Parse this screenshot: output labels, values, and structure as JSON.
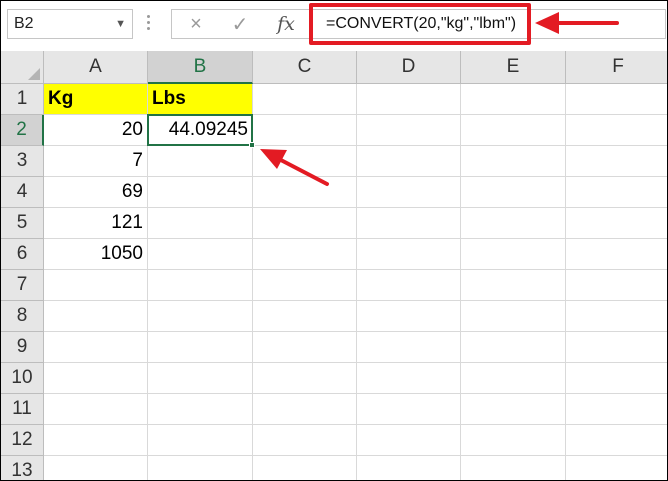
{
  "name_box": {
    "value": "B2"
  },
  "formula_bar": {
    "cancel_icon": "×",
    "enter_icon": "✓",
    "function_label": "fx",
    "formula": "=CONVERT(20,\"kg\",\"lbm\")"
  },
  "columns": [
    "A",
    "B",
    "C",
    "D",
    "E",
    "F"
  ],
  "rows": [
    "1",
    "2",
    "3",
    "4",
    "5",
    "6",
    "7",
    "8",
    "9",
    "10",
    "11",
    "12",
    "13"
  ],
  "cells": {
    "A1": "Kg",
    "B1": "Lbs",
    "A2": "20",
    "B2": "44.09245",
    "A3": "7",
    "A4": "69",
    "A5": "121",
    "A6": "1050"
  },
  "selected_cell": "B2",
  "colors": {
    "highlight": "#ffff00",
    "annotation": "#e31b23",
    "selection": "#217346"
  }
}
